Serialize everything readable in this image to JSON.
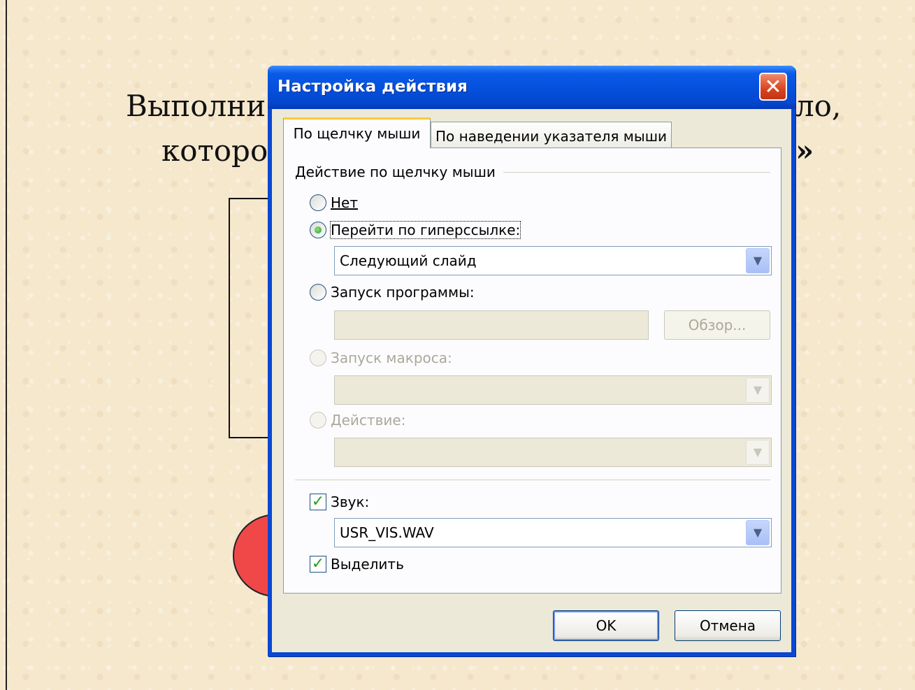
{
  "slide": {
    "line1_left": "Выполни",
    "line1_right": "ло,",
    "line2_left": "которо",
    "line2_right": "»"
  },
  "dialog": {
    "title": "Настройка действия",
    "close_symbol": "✕",
    "tabs": [
      {
        "label": "По щелчку мыши",
        "active": true
      },
      {
        "label": "По наведении указателя мыши",
        "active": false
      }
    ],
    "group_label": "Действие по щелчку мыши",
    "options": {
      "none": {
        "label": "Нет",
        "checked": false,
        "enabled": true
      },
      "hyperlink": {
        "label": "Перейти по гиперссылке:",
        "checked": true,
        "enabled": true,
        "value": "Следующий слайд"
      },
      "program": {
        "label": "Запуск программы:",
        "checked": false,
        "enabled": true,
        "value": "",
        "browse_label": "Обзор..."
      },
      "macro": {
        "label": "Запуск макроса:",
        "checked": false,
        "enabled": false,
        "value": ""
      },
      "action": {
        "label": "Действие:",
        "checked": false,
        "enabled": false,
        "value": ""
      }
    },
    "sound": {
      "label": "Звук:",
      "checked": true,
      "value": "USR_VIS.WAV"
    },
    "highlight": {
      "label": "Выделить",
      "checked": true
    },
    "ok_label": "OK",
    "cancel_label": "Отмена",
    "dropdown_arrow": "▼",
    "check_mark": "✓"
  }
}
